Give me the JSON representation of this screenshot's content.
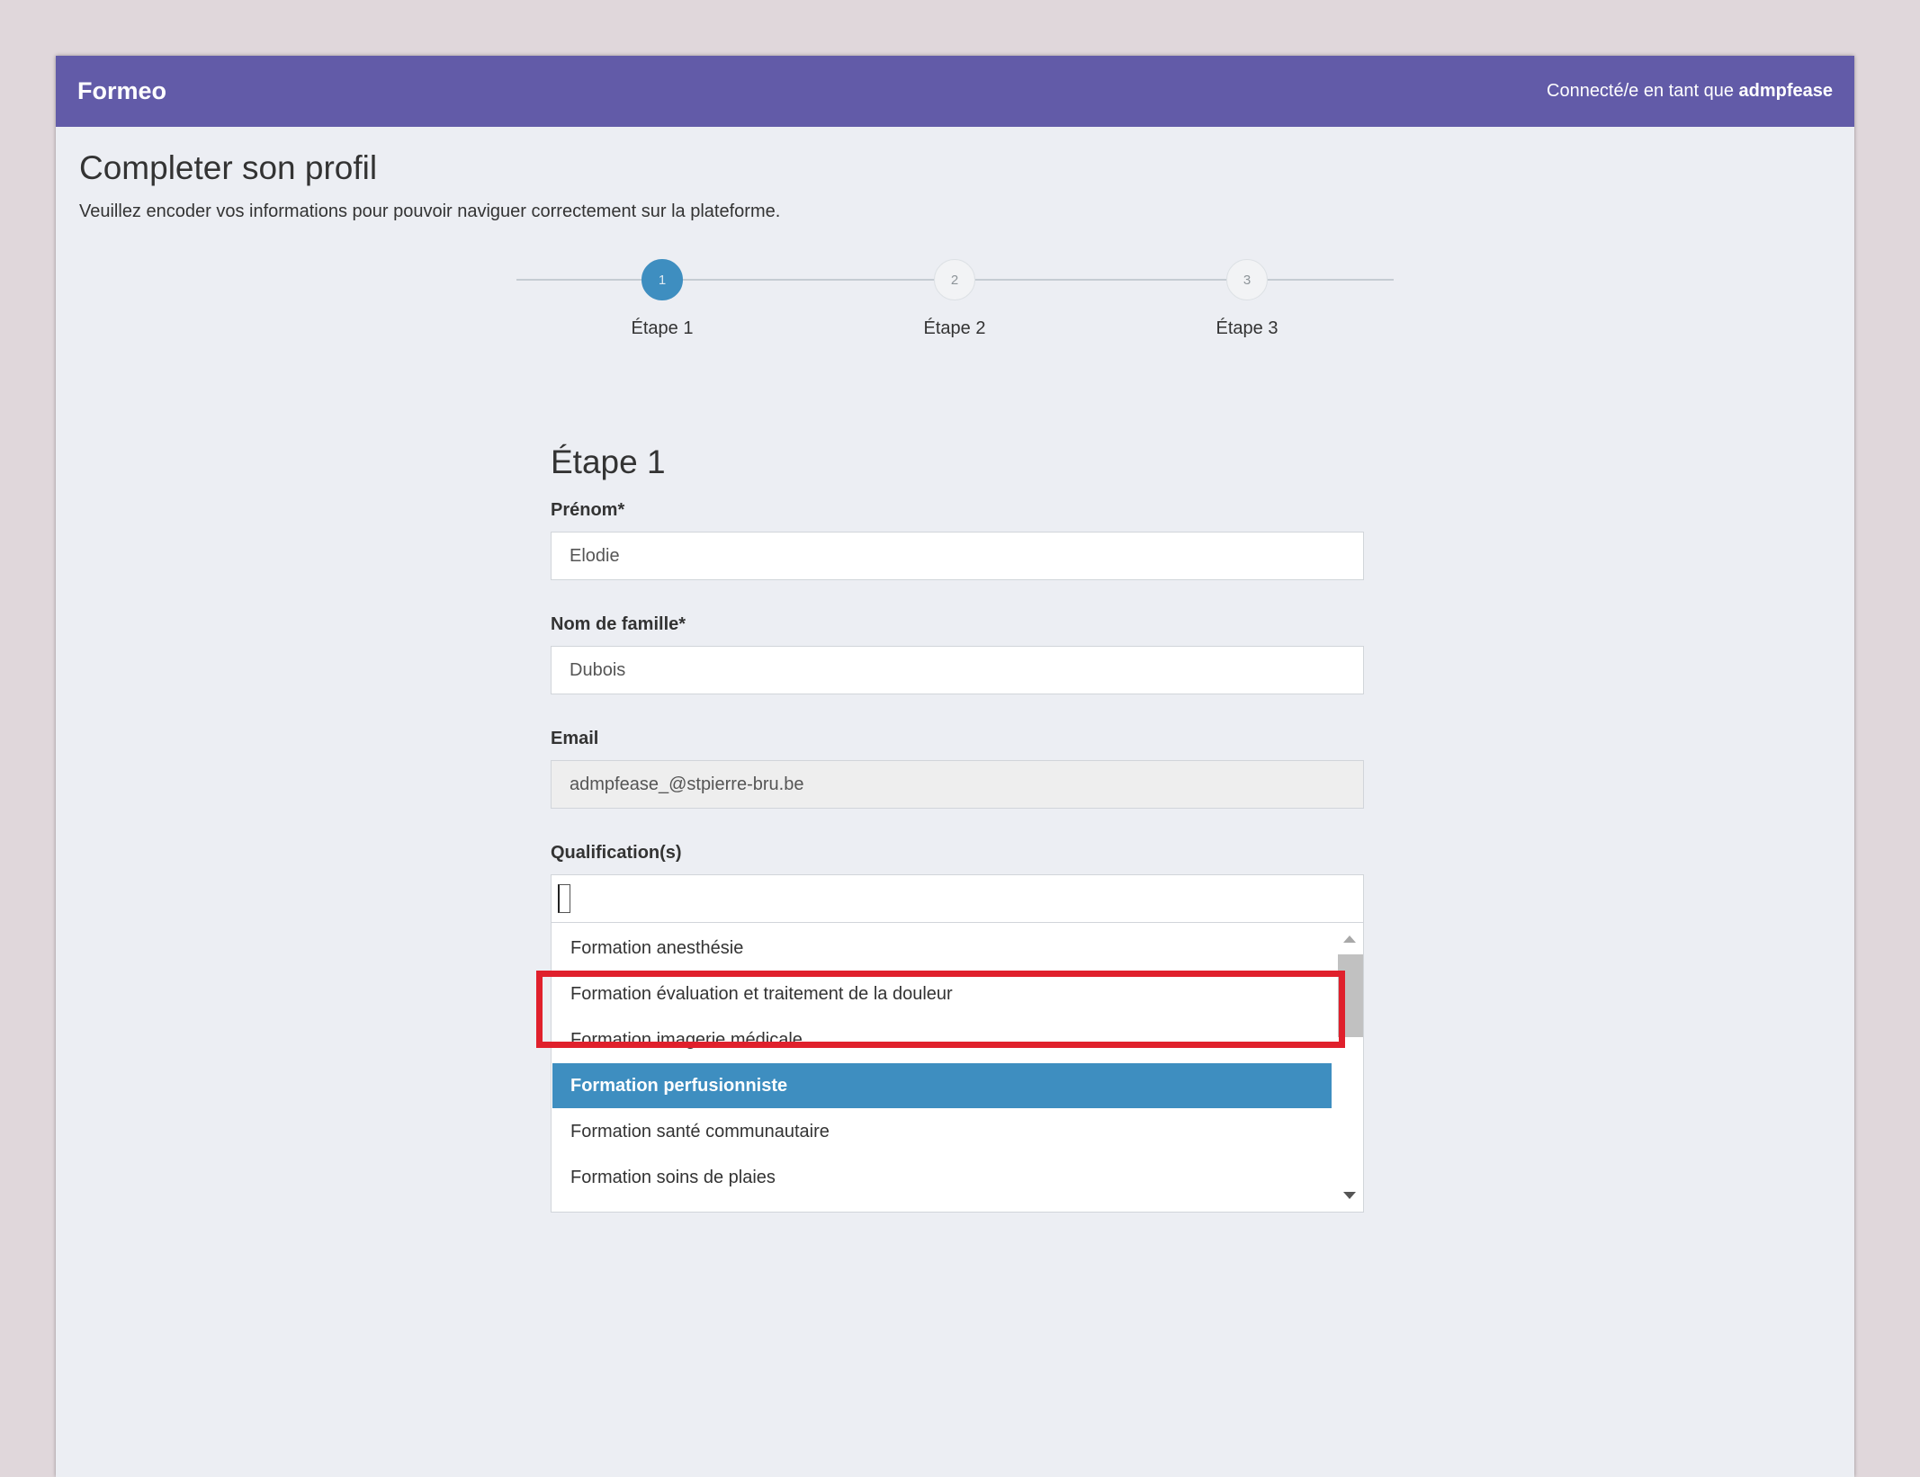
{
  "header": {
    "brand": "Formeo",
    "user_prefix": "Connecté/e en tant que ",
    "username": "admpfease",
    "color": "#625ba8"
  },
  "page": {
    "title": "Completer son profil",
    "subtitle": "Veuillez encoder vos informations pour pouvoir naviguer correctement sur la plateforme."
  },
  "stepper": {
    "steps": [
      {
        "number": "1",
        "label": "Étape 1",
        "active": true
      },
      {
        "number": "2",
        "label": "Étape 2",
        "active": false
      },
      {
        "number": "3",
        "label": "Étape 3",
        "active": false
      }
    ]
  },
  "form": {
    "heading": "Étape 1",
    "first_name": {
      "label": "Prénom*",
      "value": "Elodie"
    },
    "last_name": {
      "label": "Nom de famille*",
      "value": "Dubois"
    },
    "email": {
      "label": "Email",
      "value": "admpfease_@stpierre-bru.be",
      "disabled": true
    },
    "qualifications": {
      "label": "Qualification(s)",
      "search_value": "",
      "options": [
        "Formation anesthésie",
        "Formation évaluation et traitement de la douleur",
        "Formation imagerie médicale",
        "Formation perfusionniste",
        "Formation santé communautaire",
        "Formation soins de plaies"
      ],
      "highlighted": "Formation perfusionniste"
    }
  },
  "colors": {
    "accent": "#3e8ec0",
    "annotation": "#e0202c"
  }
}
